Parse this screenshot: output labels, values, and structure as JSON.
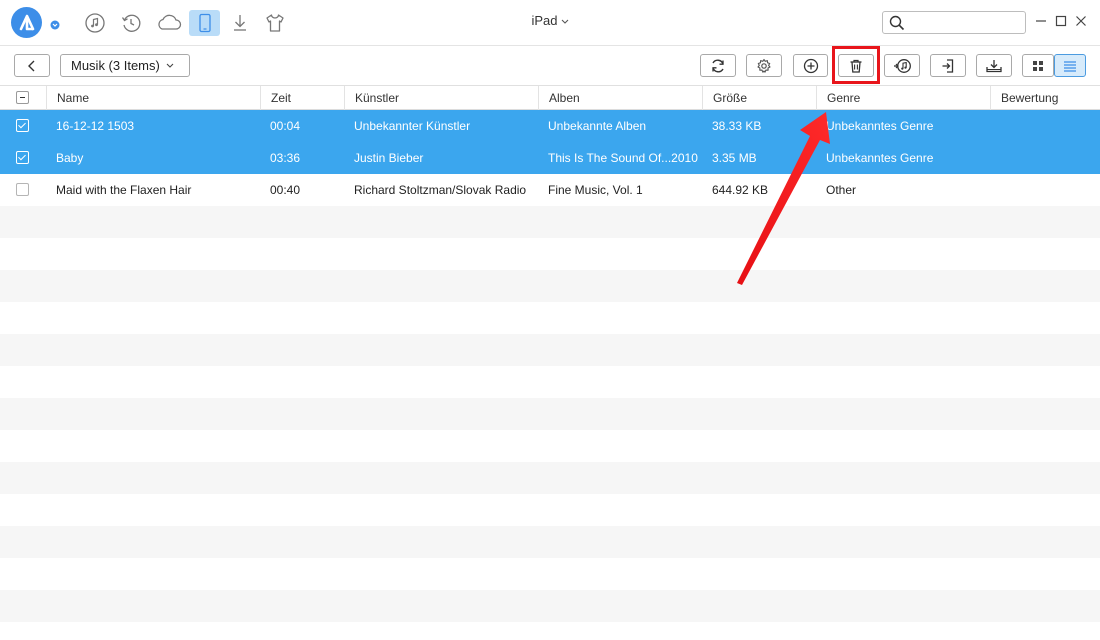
{
  "window": {
    "device_label": "iPad",
    "search": {
      "placeholder": "",
      "value": ""
    }
  },
  "topnav": {
    "items": [
      {
        "name": "music",
        "icon": "music-note-icon"
      },
      {
        "name": "restore",
        "icon": "history-icon"
      },
      {
        "name": "cloud",
        "icon": "cloud-icon"
      },
      {
        "name": "device",
        "icon": "phone-icon",
        "active": true
      },
      {
        "name": "download",
        "icon": "download-icon"
      },
      {
        "name": "shirt",
        "icon": "tshirt-icon"
      }
    ]
  },
  "toolbar": {
    "folder_label": "Musik (3 Items)",
    "buttons": [
      {
        "name": "refresh",
        "icon": "refresh-icon"
      },
      {
        "name": "settings",
        "icon": "gear-icon"
      },
      {
        "name": "add",
        "icon": "plus-circle-icon"
      },
      {
        "name": "delete",
        "icon": "trash-icon",
        "highlighted": true
      },
      {
        "name": "to-itunes",
        "icon": "itunes-icon"
      },
      {
        "name": "to-computer",
        "icon": "export-icon"
      },
      {
        "name": "to-device",
        "icon": "import-device-icon"
      },
      {
        "name": "grid-view",
        "icon": "grid-icon"
      },
      {
        "name": "list-view",
        "icon": "list-icon",
        "active": true
      }
    ]
  },
  "table": {
    "columns": [
      "Name",
      "Zeit",
      "Künstler",
      "Alben",
      "Größe",
      "Genre",
      "Bewertung"
    ],
    "rows": [
      {
        "selected": true,
        "name": "16-12-12 1503",
        "time": "00:04",
        "artist": "Unbekannter Künstler",
        "album": "Unbekannte Alben",
        "size": "38.33 KB",
        "genre": "Unbekanntes Genre",
        "rating": ""
      },
      {
        "selected": true,
        "name": "Baby",
        "time": "03:36",
        "artist": "Justin Bieber",
        "album": "This Is The Sound Of...2010",
        "size": "3.35 MB",
        "genre": "Unbekanntes Genre",
        "rating": ""
      },
      {
        "selected": false,
        "name": "Maid with the Flaxen Hair",
        "time": "00:40",
        "artist": "Richard Stoltzman/Slovak Radio",
        "album": "Fine Music, Vol. 1",
        "size": "644.92 KB",
        "genre": "Other",
        "rating": ""
      }
    ]
  },
  "colors": {
    "accent": "#3ba6ee",
    "logo": "#3d8ee8",
    "highlight": "#e8151b"
  }
}
